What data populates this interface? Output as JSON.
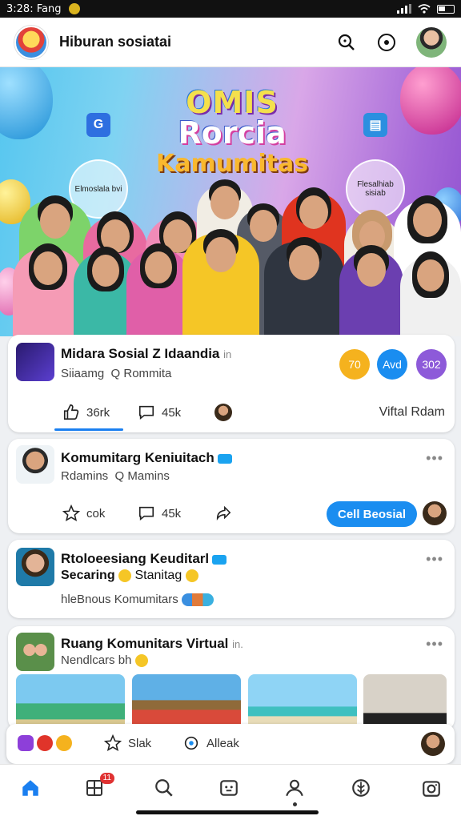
{
  "status_bar": {
    "time": "3:28: Fang"
  },
  "header": {
    "title": "Hiburan sosiatai"
  },
  "hero": {
    "title_line1": "OMIS",
    "title_line2": "Rorcia",
    "title_line3": "Kamumitas",
    "left_badge": "Elmoslala bvi",
    "right_badge": "Flesalhiab sisiab"
  },
  "post1": {
    "title": "Midara Sosial Z Idaandia",
    "title_suffix": "in",
    "subtitle": "Siiaamg  Q Rommita",
    "pills": [
      "70",
      "Avd",
      "302"
    ],
    "pill_colors": [
      "#f5b21e",
      "#1a8df0",
      "#8d5ad9"
    ],
    "like_count": "36rk",
    "comment_count": "45k",
    "link": "Viftal Rdam"
  },
  "post2": {
    "title": "Komumitarg Keniuitach",
    "subtitle": "Rdamins  Q Mamins",
    "like_count": "cok",
    "comment_count": "45k",
    "cta": "Cell Beosial"
  },
  "post3": {
    "title": "Rtoloeesiang Keuditarl",
    "subtitle": "Secaring",
    "subtitle_2": "Stanitag",
    "caption": "hleBnous Komumitars"
  },
  "post4": {
    "title": "Ruang Komunitars Virtual",
    "title_suffix": "in.",
    "subtitle": "Nendlcars bh"
  },
  "quick_bar": {
    "star_label": "Slak",
    "alert_label": "Alleak"
  },
  "bottom_nav": {
    "badge": "11"
  }
}
